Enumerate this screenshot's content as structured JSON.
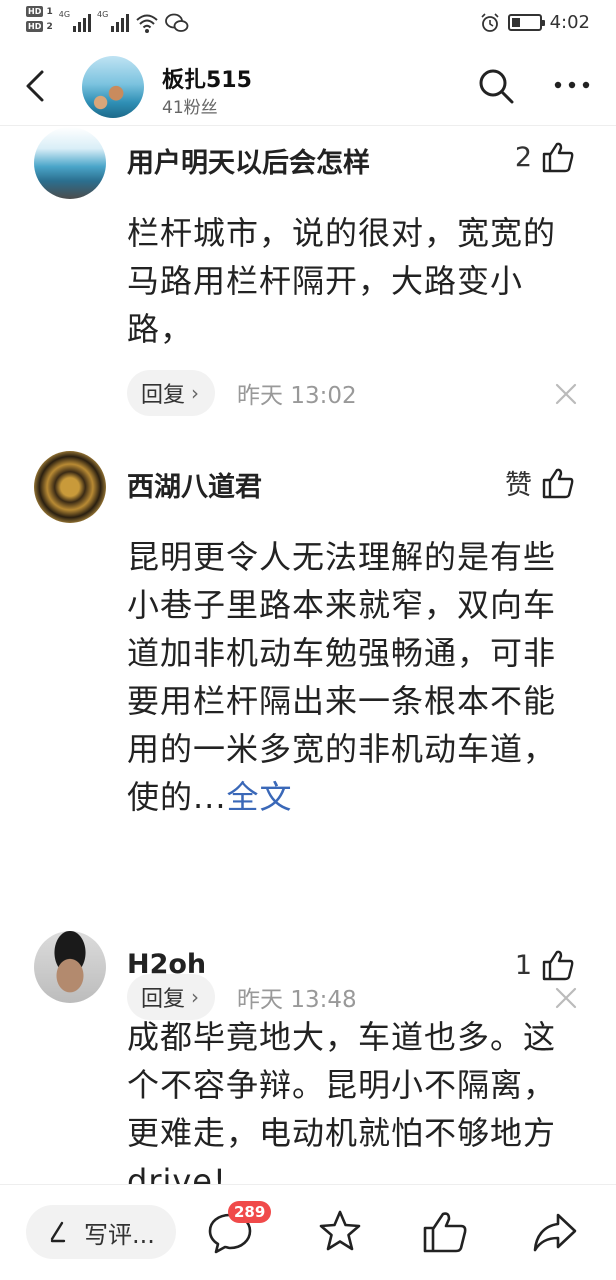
{
  "status_bar": {
    "hd1": "HD",
    "hd1_sub": "1",
    "hd2": "HD",
    "hd2_sub": "2",
    "net1": "4G",
    "net2": "4G",
    "battery_level": 0.3,
    "time": "4:02"
  },
  "header": {
    "name": "板扎515",
    "fans": "41粉丝"
  },
  "comments": [
    {
      "user": "用户明天以后会怎样",
      "likes": "2",
      "text": "栏杆城市，说的很对，宽宽的马路用栏杆隔开，大路变小路，",
      "reply_label": "回复",
      "time": "昨天  13:02"
    },
    {
      "user": "西湖八道君",
      "likes": "赞",
      "text": "昆明更令人无法理解的是有些小巷子里路本来就窄，双向车道加非机动车勉强畅通，可非要用栏杆隔出来一条根本不能用的一米多宽的非机动车道，使的...",
      "full_link": "全文",
      "reply_label": "回复",
      "time": "昨天  13:48"
    },
    {
      "user": "H2oh",
      "likes": "1",
      "text": "成都毕竟地大，车道也多。这个不容争辩。昆明小不隔离，更难走，电动机就怕不够地方drive!"
    }
  ],
  "bottom_bar": {
    "write_label": "写评...",
    "comment_count": "289"
  },
  "icons": {
    "back": "back-arrow-icon",
    "search": "search-icon",
    "more": "more-icon",
    "like": "thumbs-up-icon",
    "close": "close-icon",
    "comment": "comment-bubble-icon",
    "star": "star-icon",
    "share": "share-icon"
  }
}
